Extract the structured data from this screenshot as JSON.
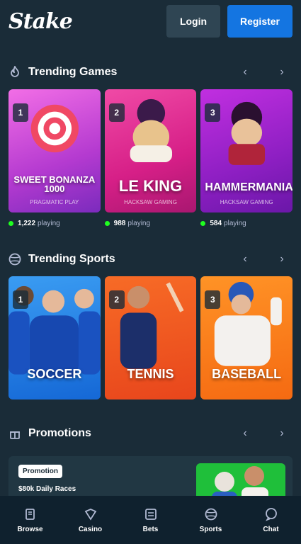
{
  "header": {
    "logo": "Stake",
    "login_label": "Login",
    "register_label": "Register"
  },
  "trending_games": {
    "title": "Trending Games",
    "icon": "flame-icon",
    "cards": [
      {
        "rank": "1",
        "title": "SWEET BONANZA 1000",
        "subtitle": "PRAGMATIC PLAY",
        "players": "1,222",
        "players_label": "playing",
        "color": "#e94bd8"
      },
      {
        "rank": "2",
        "title": "LE KING",
        "subtitle": "HACKSAW GAMING",
        "players": "988",
        "players_label": "playing",
        "color": "#e0299a"
      },
      {
        "rank": "3",
        "title": "HAMMERMANIA",
        "subtitle": "HACKSAW GAMING",
        "players": "584",
        "players_label": "playing",
        "color": "#9e22c8"
      }
    ]
  },
  "trending_sports": {
    "title": "Trending Sports",
    "icon": "sports-ball-icon",
    "cards": [
      {
        "rank": "1",
        "title": "SOCCER",
        "color": "#1676e6"
      },
      {
        "rank": "2",
        "title": "TENNIS",
        "color": "#f1571f"
      },
      {
        "rank": "3",
        "title": "BASEBALL",
        "color": "#f77d16"
      }
    ]
  },
  "promotions": {
    "title": "Promotions",
    "icon": "gift-icon",
    "badge": "Promotion",
    "text": "$80k Daily Races"
  },
  "bottom_nav": [
    {
      "label": "Browse",
      "icon": "browse-icon"
    },
    {
      "label": "Casino",
      "icon": "casino-icon"
    },
    {
      "label": "Bets",
      "icon": "bets-icon"
    },
    {
      "label": "Sports",
      "icon": "sports-icon"
    },
    {
      "label": "Chat",
      "icon": "chat-icon"
    }
  ],
  "colors": {
    "background": "#1a2c38",
    "nav_background": "#0f212e",
    "accent": "#1475e1",
    "online": "#1fff20"
  }
}
